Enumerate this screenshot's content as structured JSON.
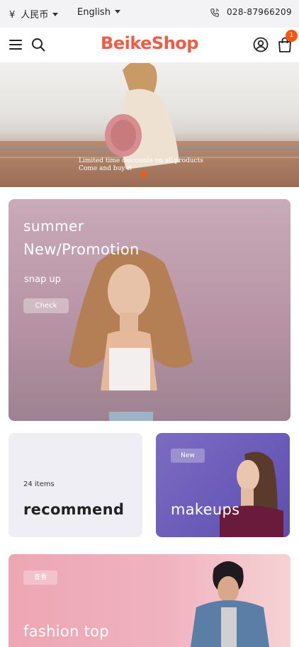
{
  "topbar": {
    "currency_symbol": "¥",
    "currency_label": "人民币",
    "language_label": "English",
    "phone": "028-87966209"
  },
  "header": {
    "logo_text": "BeikeShop",
    "cart_count": "1",
    "brand_color": "#ef5b45",
    "accent_color": "#fd560f"
  },
  "hero": {
    "caption_line1": "Limited time discounts on all products",
    "caption_line2": "Come and buy it"
  },
  "promo": {
    "title_line1": "summer",
    "title_line2": "New/Promotion",
    "subtitle": "snap up",
    "button_label": "Check"
  },
  "recommend": {
    "count": "24 items",
    "title": "recommend"
  },
  "makeups": {
    "badge": "New",
    "title": "makeups"
  },
  "fashion": {
    "badge": "查看",
    "title": "fashion top"
  }
}
